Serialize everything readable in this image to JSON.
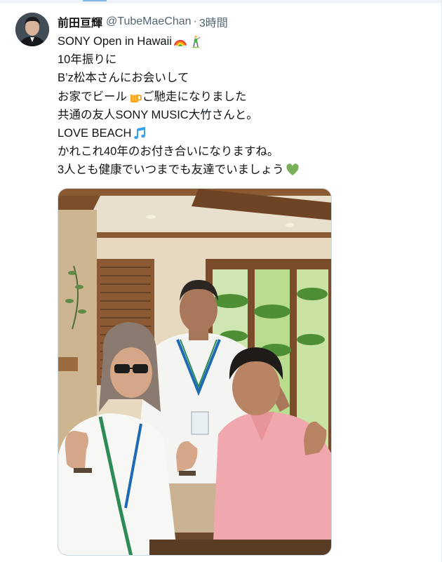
{
  "tweet": {
    "display_name": "前田亘輝",
    "handle": "@TubeMaeChan",
    "separator": "·",
    "timestamp": "3時間",
    "lines": [
      "SONY Open in Hawaii",
      "10年振りに",
      "B’z松本さんにお会いして",
      "お家でビール",
      "ご馳走になりました",
      "共通の友人SONY MUSIC大竹さんと。",
      "LOVE BEACH",
      "かれこれ40年のお付き合いになりますね。",
      "3人とも健康でいつまでも友達でいましょう"
    ],
    "emojis": [
      "rainbow-icon",
      "golfer-icon",
      "beer-mug-icon",
      "musical-notes-icon",
      "green-heart-icon"
    ]
  },
  "colors": {
    "text": "#0f1419",
    "secondary": "#536471",
    "border": "#cfd9de"
  }
}
